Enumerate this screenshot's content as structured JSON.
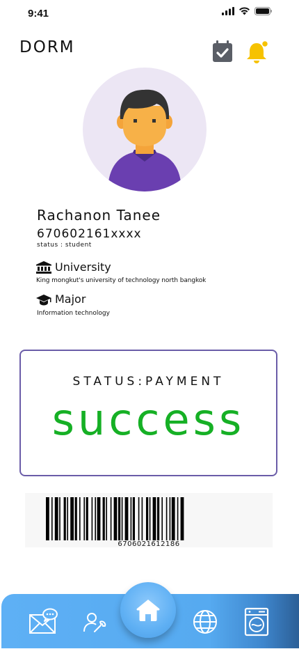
{
  "status_bar": {
    "time": "9:41"
  },
  "header": {
    "brand": "DORM",
    "calendar_icon": "calendar-check-icon",
    "bell_icon": "bell-icon",
    "accent": "#f6c200"
  },
  "profile": {
    "name": "Rachanon Tanee",
    "student_id": "670602161xxxx",
    "status": "status : student",
    "university": {
      "label": "University",
      "value": "King mongkut's university of technology north bangkok"
    },
    "major": {
      "label": "Major",
      "value": "Information technology"
    }
  },
  "payment": {
    "title": "STATUS:PAYMENT",
    "value": "success",
    "value_color": "#16b025",
    "border_color": "#6a5ca8"
  },
  "barcode": {
    "number": "6706021612186"
  },
  "nav": {
    "items": [
      "mail-chat-icon",
      "user-tool-icon",
      "home-icon",
      "globe-icon",
      "washing-machine-icon"
    ]
  }
}
